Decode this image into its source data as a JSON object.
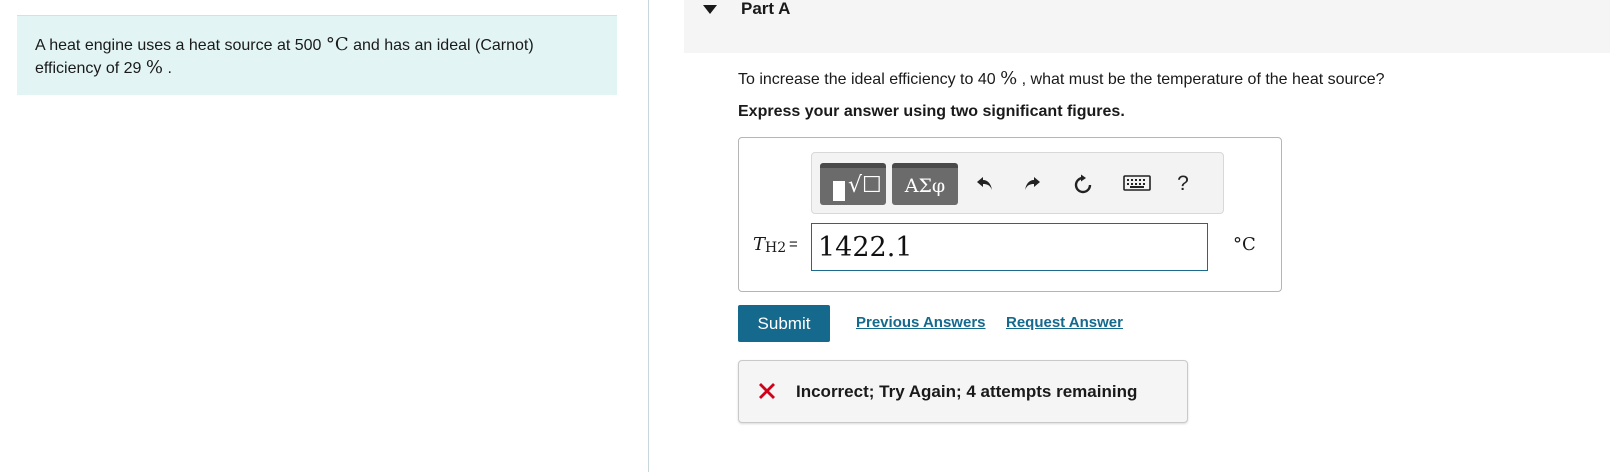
{
  "problem": {
    "text_before_temp": "A heat engine uses a heat source at 500 ",
    "temp_unit": "°C",
    "text_after_temp": " and has an ideal (Carnot)",
    "text_line2": "efficiency of 29 ",
    "percent_symbol": "%",
    "text_end": " ."
  },
  "part": {
    "title": "Part A"
  },
  "question": {
    "text_before": "To increase the ideal efficiency to 40 ",
    "percent_symbol": "%",
    "text_after": " , what must be the temperature of the heat source?",
    "instruction": "Express your answer using two significant figures."
  },
  "toolbar": {
    "greek_label": "ΑΣφ",
    "template_glyph": "√☐",
    "help_label": "?"
  },
  "answer": {
    "variable": "T",
    "subscript": "H2",
    "equals": "=",
    "value": "1422.1",
    "unit": "°C"
  },
  "actions": {
    "submit_label": "Submit",
    "previous_answers_label": "Previous Answers",
    "request_answer_label": "Request Answer"
  },
  "feedback": {
    "message": "Incorrect; Try Again; 4 attempts remaining",
    "icon": "x-mark-icon",
    "color": "#d0021b"
  },
  "colors": {
    "accent": "#14698d",
    "problem_bg": "#e2f4f4"
  }
}
